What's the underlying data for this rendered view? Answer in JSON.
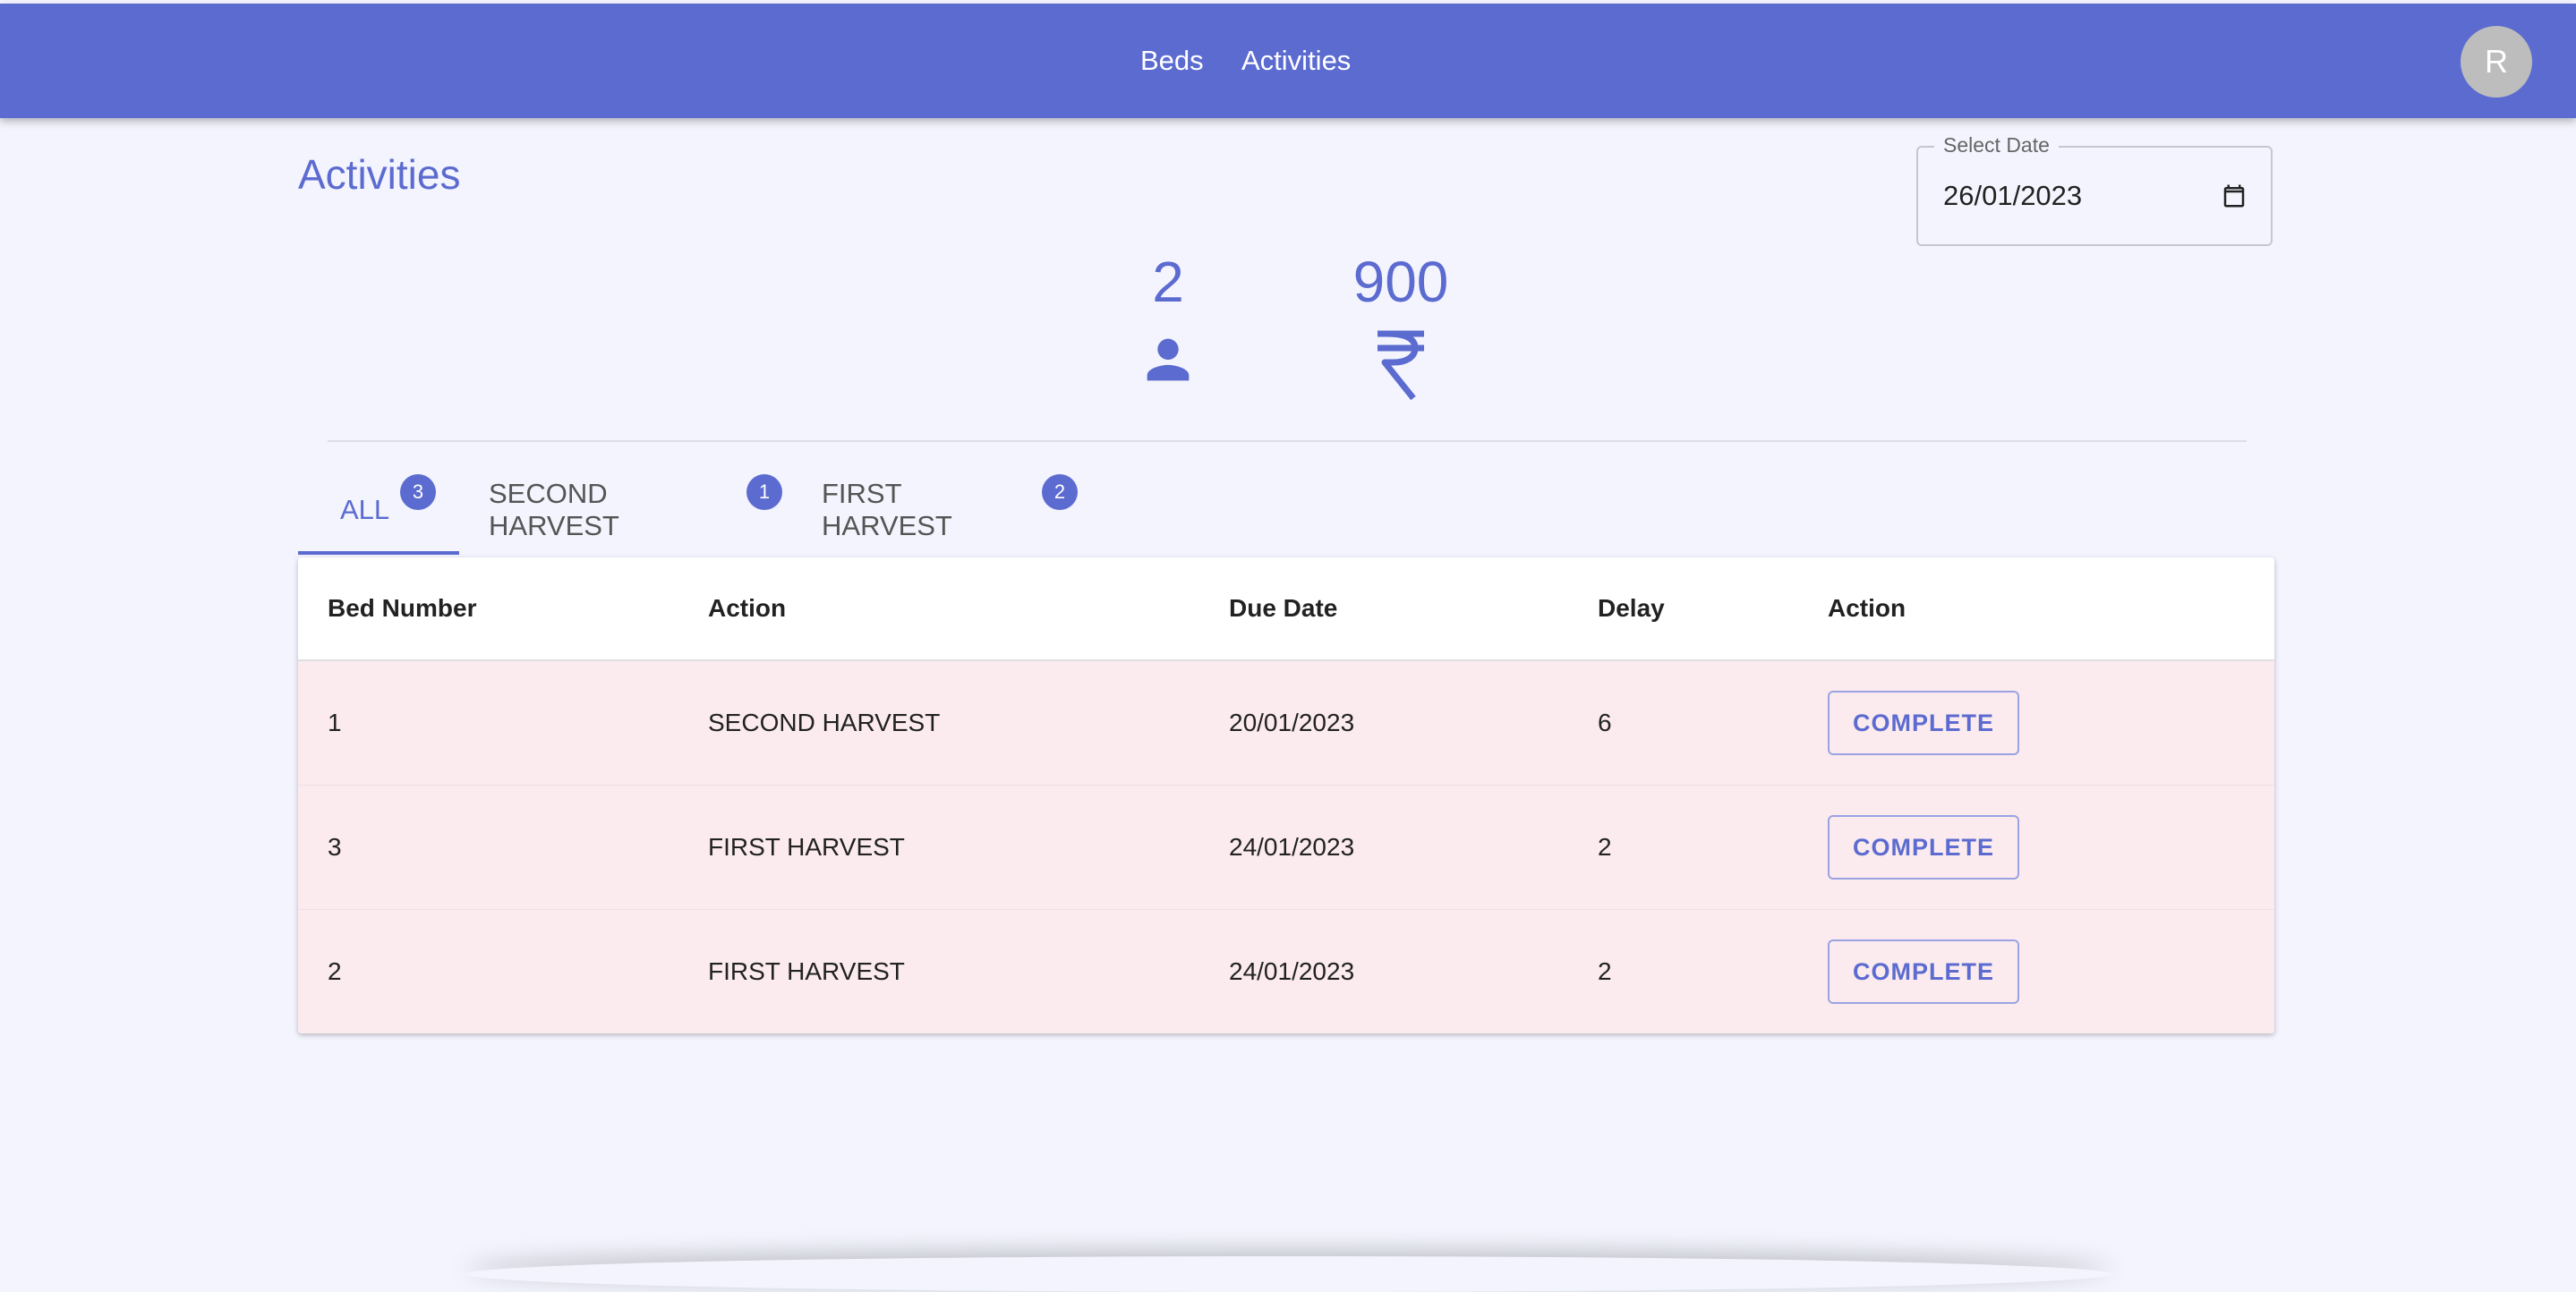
{
  "nav": {
    "beds": "Beds",
    "activities": "Activities"
  },
  "avatar_initial": "R",
  "page_title": "Activities",
  "date_picker": {
    "label": "Select Date",
    "value": "26/01/2023"
  },
  "stats": {
    "people": "2",
    "amount": "900"
  },
  "tabs": [
    {
      "label": "ALL",
      "count": "3"
    },
    {
      "label": "SECOND HARVEST",
      "count": "1"
    },
    {
      "label": "FIRST HARVEST",
      "count": "2"
    }
  ],
  "table": {
    "headers": [
      "Bed Number",
      "Action",
      "Due Date",
      "Delay",
      "Action"
    ],
    "rows": [
      {
        "bed": "1",
        "action": "SECOND HARVEST",
        "due": "20/01/2023",
        "delay": "6",
        "button": "COMPLETE"
      },
      {
        "bed": "3",
        "action": "FIRST HARVEST",
        "due": "24/01/2023",
        "delay": "2",
        "button": "COMPLETE"
      },
      {
        "bed": "2",
        "action": "FIRST HARVEST",
        "due": "24/01/2023",
        "delay": "2",
        "button": "COMPLETE"
      }
    ]
  },
  "colors": {
    "primary": "#5c6bd0",
    "row_highlight": "#fbebee",
    "background": "#f3f4fd"
  },
  "icons": {
    "people": "person-icon",
    "amount": "rupee-icon",
    "calendar": "calendar-icon"
  }
}
